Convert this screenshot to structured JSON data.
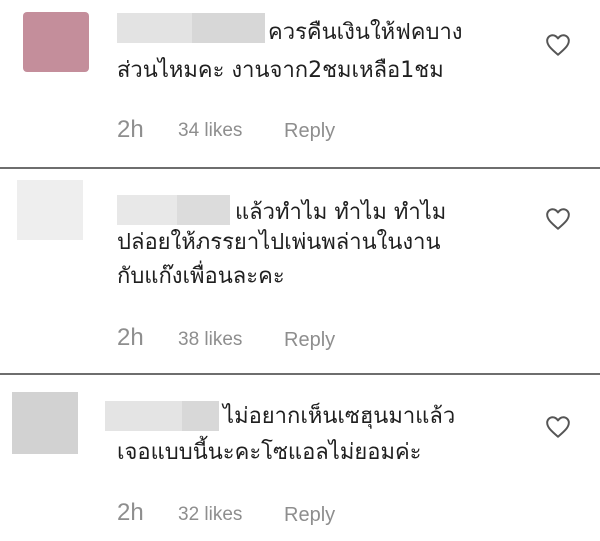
{
  "comments": [
    {
      "text_lines": [
        "ควรคืนเงินให้ฟคบาง",
        "ส่วนไหมคะ งานจาก2ชมเหลือ1ชม"
      ],
      "time": "2h",
      "likes": "34 likes",
      "reply_label": "Reply",
      "avatar_color": "#c48e9b"
    },
    {
      "text_lines": [
        "แล้วทำไม ทำไม ทำไม",
        "ปล่อยให้ภรรยาไปเพ่นพล่านในงาน",
        "กับแก๊งเพื่อนละคะ"
      ],
      "time": "2h",
      "likes": "38 likes",
      "reply_label": "Reply",
      "avatar_color": "#eeeeee"
    },
    {
      "text_lines": [
        "ไม่อยากเห็นเซฮุนมาแล้ว",
        "เจอแบบนี้นะคะโซแอลไม่ยอมค่ะ"
      ],
      "time": "2h",
      "likes": "32 likes",
      "reply_label": "Reply",
      "avatar_color": "#d2d2d2"
    }
  ],
  "icons": {
    "like": "heart-outline-icon"
  }
}
